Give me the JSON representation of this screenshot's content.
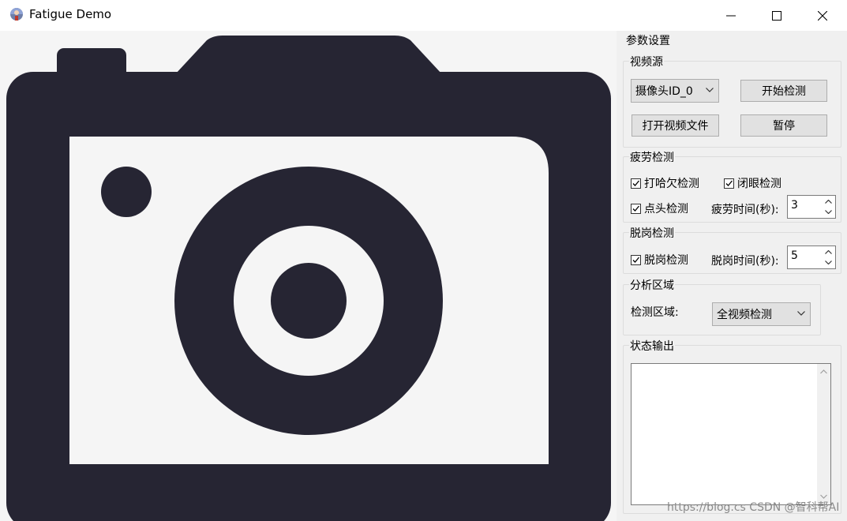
{
  "window": {
    "title": "Fatigue Demo"
  },
  "panel": {
    "title": "参数设置",
    "video_source": {
      "title": "视频源",
      "camera_select": "摄像头ID_0",
      "start_button": "开始检测",
      "open_file_button": "打开视频文件",
      "pause_button": "暂停"
    },
    "fatigue": {
      "title": "疲劳检测",
      "yawn_label": "打哈欠检测",
      "yawn_checked": true,
      "eye_label": "闭眼检测",
      "eye_checked": true,
      "nod_label": "点头检测",
      "nod_checked": true,
      "time_label": "疲劳时间(秒):",
      "time_value": "3"
    },
    "leave": {
      "title": "脱岗检测",
      "check_label": "脱岗检测",
      "checked": true,
      "time_label": "脱岗时间(秒):",
      "time_value": "5"
    },
    "region": {
      "title": "分析区域",
      "label": "检测区域:",
      "select": "全视频检测"
    },
    "status": {
      "title": "状态输出",
      "text": ""
    }
  },
  "watermark": "https://blog.cs CSDN @智科帮AI",
  "colors": {
    "camera_icon": "#262533",
    "video_background": "#f5f5f5"
  },
  "icons": {
    "app": "parachute-icon",
    "video_placeholder": "camera-icon"
  }
}
